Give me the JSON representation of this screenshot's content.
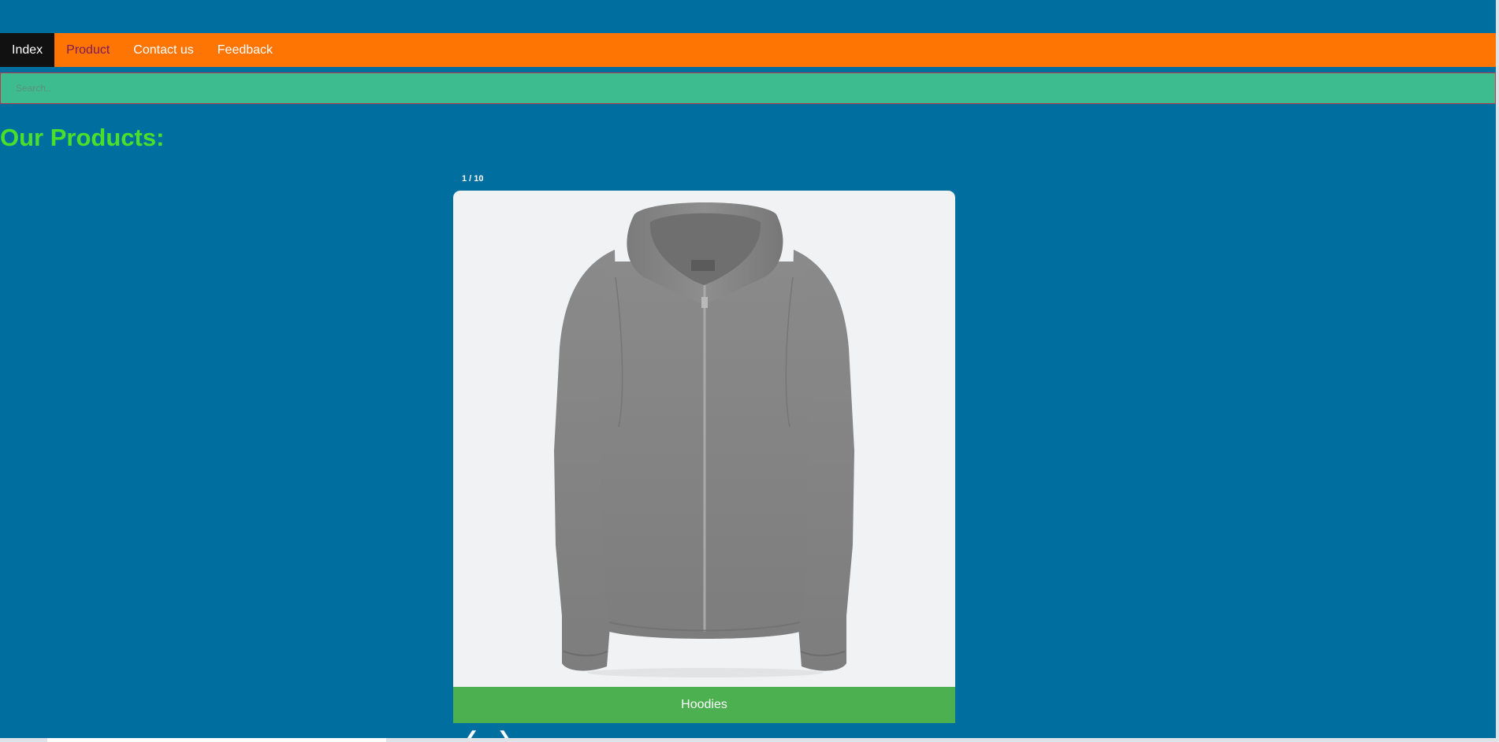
{
  "nav": {
    "items": [
      {
        "label": "Index",
        "state": "active"
      },
      {
        "label": "Product",
        "state": "visited"
      },
      {
        "label": "Contact us",
        "state": "normal"
      },
      {
        "label": "Feedback",
        "state": "normal"
      }
    ]
  },
  "search": {
    "placeholder": "Search.."
  },
  "main": {
    "title": "Our Products:"
  },
  "slideshow": {
    "counter": "1 / 10",
    "caption": "Hoodies",
    "prev_icon": "❮",
    "next_icon": "❯",
    "image_icon": "gray-zip-hoodie-image"
  },
  "colors": {
    "page_background": "#006fa0",
    "navbar": "#ff7504",
    "active_nav": "#111111",
    "search_background": "#3dbd8f",
    "title": "#48e02a",
    "caption_background": "#4caf50"
  }
}
